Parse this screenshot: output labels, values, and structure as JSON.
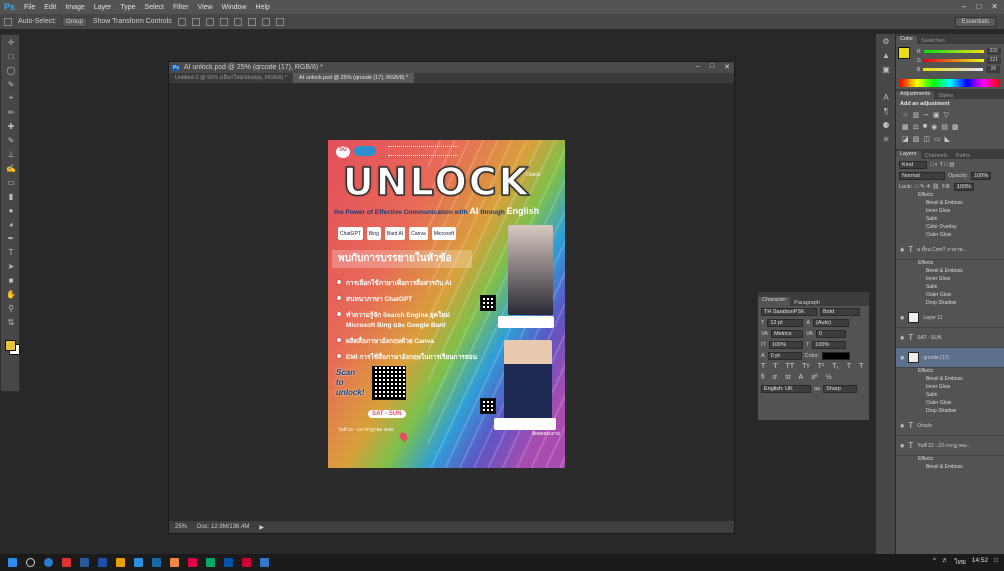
{
  "app": {
    "logo": "Ps",
    "menu": [
      "File",
      "Edit",
      "Image",
      "Layer",
      "Type",
      "Select",
      "Filter",
      "View",
      "Window",
      "Help"
    ],
    "workspace": "Essentials"
  },
  "options": {
    "auto_select": "Auto-Select:",
    "group": "Group",
    "transform": "Show Transform Controls"
  },
  "doc": {
    "window_title": "AI unlock.psd @ 25% (qrcode (17), RGB/8) *",
    "tabs": [
      "Untitled-2 @ 50% (เลือกใหม่ของคุณ, RGB/8) *",
      "AI unlock.psd @ 25% (qrcode (17), RGB/8) *"
    ],
    "zoom": "25%",
    "doc_size": "Doc: 12.9M/136.4M"
  },
  "poster": {
    "title": "UNLOCK",
    "oracle": "Oracle",
    "subtitle": "the Power of Effective Communication with",
    "ai": "AI",
    "through": "through",
    "english": "English",
    "logos": [
      "ChatGPT",
      "Bing",
      "Bard AI",
      "Canva",
      "Microsoft"
    ],
    "banner": "พบกับการบรรยายในหัวข้อ",
    "items": [
      "การเลือกใช้ภาษาเพื่อการสื่อสารกับ AI",
      "สนทนาภาษา ChatGPT",
      "ทำความรู้จัก Search Engine ยุคใหม่ Microsoft Bing และ Google Bard",
      "ผลิตสื่อภาษาอังกฤษด้วย Canva",
      "EMI การใช้สื่อภาษาอังกฤษในการเรียนการสอน"
    ],
    "scan": [
      "Scan",
      "to",
      "unlock!"
    ],
    "satsun": "SAT - SUN",
    "dates": "วันที่ 22 - 23 กรกฎาคม 2566",
    "footer": "ติดต่อสอบถาม"
  },
  "character": {
    "tabs": [
      "Character",
      "Paragraph"
    ],
    "font": "TH SarabunPSK",
    "style": "Bold",
    "size": "12 pt",
    "leading": "(Auto)",
    "kerning": "Metrics",
    "tracking": "0",
    "vscale": "100%",
    "hscale": "100%",
    "baseline": "0 pt",
    "color_label": "Color:",
    "lang": "English: UK",
    "aa": "Sharp"
  },
  "color": {
    "tabs": [
      "Color",
      "Swatches"
    ],
    "r": "232",
    "g": "221",
    "b": "26",
    "fg": "#e8dd1a"
  },
  "adjust": {
    "tabs": [
      "Adjustments",
      "Styles"
    ],
    "title": "Add an adjustment"
  },
  "layers": {
    "tabs": [
      "Layers",
      "Channels",
      "Paths"
    ],
    "kind": "Kind",
    "mode": "Normal",
    "opacity_label": "Opacity:",
    "opacity": "100%",
    "lock_label": "Lock:",
    "fill_label": "Fill:",
    "fill": "100%",
    "rows": [
      {
        "type": "effects",
        "labels": [
          "Effects",
          "Bevel & Emboss",
          "Inner Glow",
          "Satin",
          "Color Overlay",
          "Outer Glow"
        ]
      },
      {
        "type": "text",
        "name": "ผ ทั้งน Com? ภาษาพ..."
      },
      {
        "type": "effects",
        "labels": [
          "Effects",
          "Bevel & Emboss",
          "Inner Glow",
          "Satin",
          "Outer Glow",
          "Drop Shadow"
        ]
      },
      {
        "type": "image",
        "name": "Layer 11"
      },
      {
        "type": "text",
        "name": "SAT - SUN"
      },
      {
        "type": "image",
        "name": "qrcode (17)",
        "selected": true
      },
      {
        "type": "effects",
        "labels": [
          "Effects",
          "Bevel & Emboss",
          "Inner Glow",
          "Satin",
          "Outer Glow",
          "Drop Shadow"
        ]
      },
      {
        "type": "text",
        "name": "Oracle"
      },
      {
        "type": "text",
        "name": "วันที่ 22 - 23 กรกฎาคม..."
      },
      {
        "type": "effects",
        "labels": [
          "Effects",
          "Bevel & Emboss"
        ]
      }
    ]
  },
  "tray": {
    "time": "14:52",
    "lang": "ไทย"
  }
}
